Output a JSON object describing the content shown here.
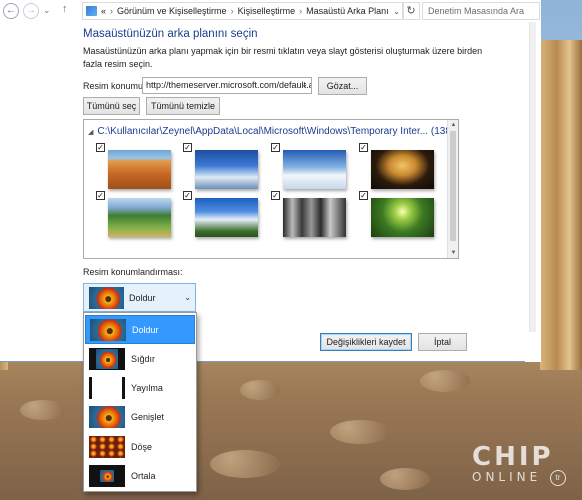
{
  "nav": {
    "back_icon": "back-arrow-icon",
    "forward_icon": "forward-arrow-icon",
    "history_icon": "chevron-down-icon",
    "up_icon": "up-arrow-icon",
    "overflow": "«",
    "breadcrumbs": [
      "Görünüm ve Kişiselleştirme",
      "Kişiselleştirme",
      "Masaüstü Arka Planı"
    ],
    "search_placeholder": "Denetim Masasında Ara"
  },
  "page": {
    "title": "Masaüstünüzün arka planını seçin",
    "description": "Masaüstünüzün arka planı yapmak için bir resmi tıklatın veya slayt gösterisi oluşturmak üzere birden fazla resim seçin.",
    "location_label": "Resim konumu:",
    "location_value": "http://themeserver.microsoft.com/default.a",
    "browse_button": "Gözat...",
    "select_all_button": "Tümünü seç",
    "clear_all_button": "Tümünü temizle"
  },
  "gallery": {
    "path_header": "C:\\Kullanıcılar\\Zeynel\\AppData\\Local\\Microsoft\\Windows\\Temporary Inter...",
    "count": "(138)",
    "items": [
      {
        "name": "desert-dunes",
        "checked": true
      },
      {
        "name": "snowy-forest",
        "checked": true
      },
      {
        "name": "snowy-mountain",
        "checked": true
      },
      {
        "name": "stone-arches",
        "checked": true
      },
      {
        "name": "green-valley",
        "checked": true
      },
      {
        "name": "cloudy-hills",
        "checked": true
      },
      {
        "name": "bw-forest",
        "checked": true
      },
      {
        "name": "sunny-forest",
        "checked": true
      }
    ]
  },
  "position": {
    "label": "Resim konumlandırması:",
    "selected": "Doldur",
    "options": [
      "Doldur",
      "Sığdır",
      "Yayılma",
      "Genişlet",
      "Döşe",
      "Ortala"
    ]
  },
  "footer": {
    "save_button": "Değişiklikleri kaydet",
    "cancel_button": "İptal"
  },
  "watermark": {
    "brand": "CHIP",
    "sub": "ONLINE",
    "tld": "tr"
  },
  "colors": {
    "link_title": "#1b3d8f",
    "selection": "#3399ff"
  }
}
